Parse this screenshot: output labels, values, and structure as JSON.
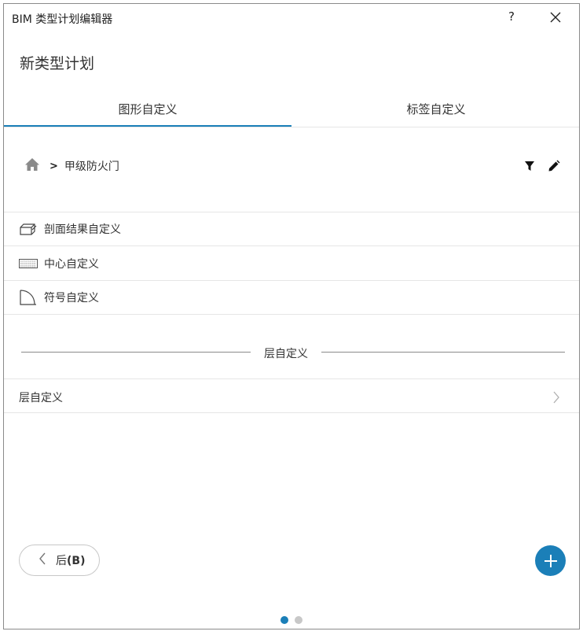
{
  "window": {
    "title": "BIM 类型计划编辑器",
    "help_label": "?"
  },
  "page": {
    "heading": "新类型计划"
  },
  "tabs": [
    {
      "label": "图形自定义",
      "active": true
    },
    {
      "label": "标签自定义",
      "active": false
    }
  ],
  "breadcrumb": {
    "separator": ">",
    "current": "甲级防火门"
  },
  "customization_items": [
    {
      "label": "剖面结果自定义",
      "icon": "section-box-icon"
    },
    {
      "label": "中心自定义",
      "icon": "hatch-pattern-icon"
    },
    {
      "label": "符号自定义",
      "icon": "door-swing-icon"
    }
  ],
  "layer_section": {
    "divider_label": "层自定义",
    "row_label": "层自定义"
  },
  "footer": {
    "back_label": "后",
    "back_shortcut": "(B)"
  },
  "pagination": {
    "total": 2,
    "current": 1
  },
  "colors": {
    "accent": "#1b7fb8",
    "dot_inactive": "#c8c8c8"
  }
}
